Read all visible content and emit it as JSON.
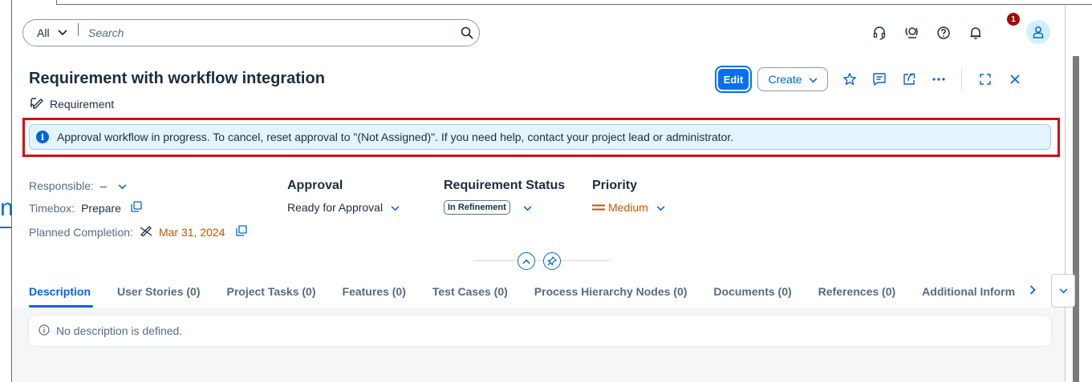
{
  "search": {
    "scope": "All",
    "placeholder": "Search"
  },
  "shell": {
    "notifications_count": "1"
  },
  "object": {
    "title": "Requirement with workflow integration",
    "type": "Requirement"
  },
  "actions": {
    "edit": "Edit",
    "create": "Create"
  },
  "message": "Approval workflow in progress. To cancel, reset approval to \"(Not Assigned)\". If you need help, contact your project lead or administrator.",
  "fields": {
    "responsible_label": "Responsible:",
    "responsible_value": "–",
    "timebox_label": "Timebox:",
    "timebox_value": "Prepare",
    "planned_label": "Planned Completion:",
    "planned_value": "Mar 31, 2024"
  },
  "approval": {
    "label": "Approval",
    "value": "Ready for Approval"
  },
  "status": {
    "label": "Requirement Status",
    "value": "In Refinement"
  },
  "priority": {
    "label": "Priority",
    "value": "Medium"
  },
  "tabs": [
    "Description",
    "User Stories (0)",
    "Project Tasks (0)",
    "Features (0)",
    "Test Cases (0)",
    "Process Hierarchy Nodes (0)",
    "Documents (0)",
    "References (0)",
    "Additional Inform"
  ],
  "description_empty": "No description is defined.",
  "colors": {
    "brand": "#0070f2",
    "message_bg": "#e1f4ff",
    "highlight": "#d20a11",
    "warning": "#c35500"
  }
}
